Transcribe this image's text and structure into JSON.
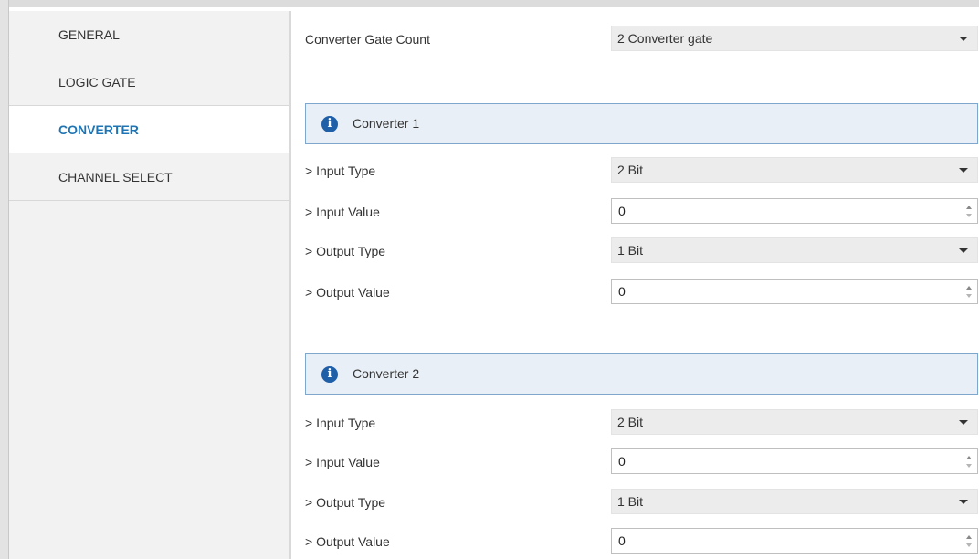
{
  "sidebar": {
    "items": [
      {
        "label": "GENERAL"
      },
      {
        "label": "LOGIC GATE"
      },
      {
        "label": "CONVERTER"
      },
      {
        "label": "CHANNEL SELECT"
      }
    ]
  },
  "main": {
    "gate_count": {
      "label": "Converter Gate Count",
      "value": "2 Converter gate"
    },
    "converters": [
      {
        "title": "Converter 1",
        "input_type": {
          "label": "> Input Type",
          "value": "2 Bit"
        },
        "input_value": {
          "label": "> Input Value",
          "value": "0"
        },
        "output_type": {
          "label": "> Output Type",
          "value": "1 Bit"
        },
        "output_value": {
          "label": "> Output Value",
          "value": "0"
        }
      },
      {
        "title": "Converter 2",
        "input_type": {
          "label": "> Input Type",
          "value": "2 Bit"
        },
        "input_value": {
          "label": "> Input Value",
          "value": "0"
        },
        "output_type": {
          "label": "> Output Type",
          "value": "1 Bit"
        },
        "output_value": {
          "label": "> Output Value",
          "value": "0"
        }
      }
    ]
  },
  "colors": {
    "accent": "#1f74b4",
    "section_bg": "#e8eff6",
    "section_border": "#7fa6cc",
    "info_icon": "#1f5fa8"
  },
  "icons": {
    "section": "info-icon",
    "select": "chevron-down-icon",
    "spinner": "spinner-arrows-icon"
  }
}
